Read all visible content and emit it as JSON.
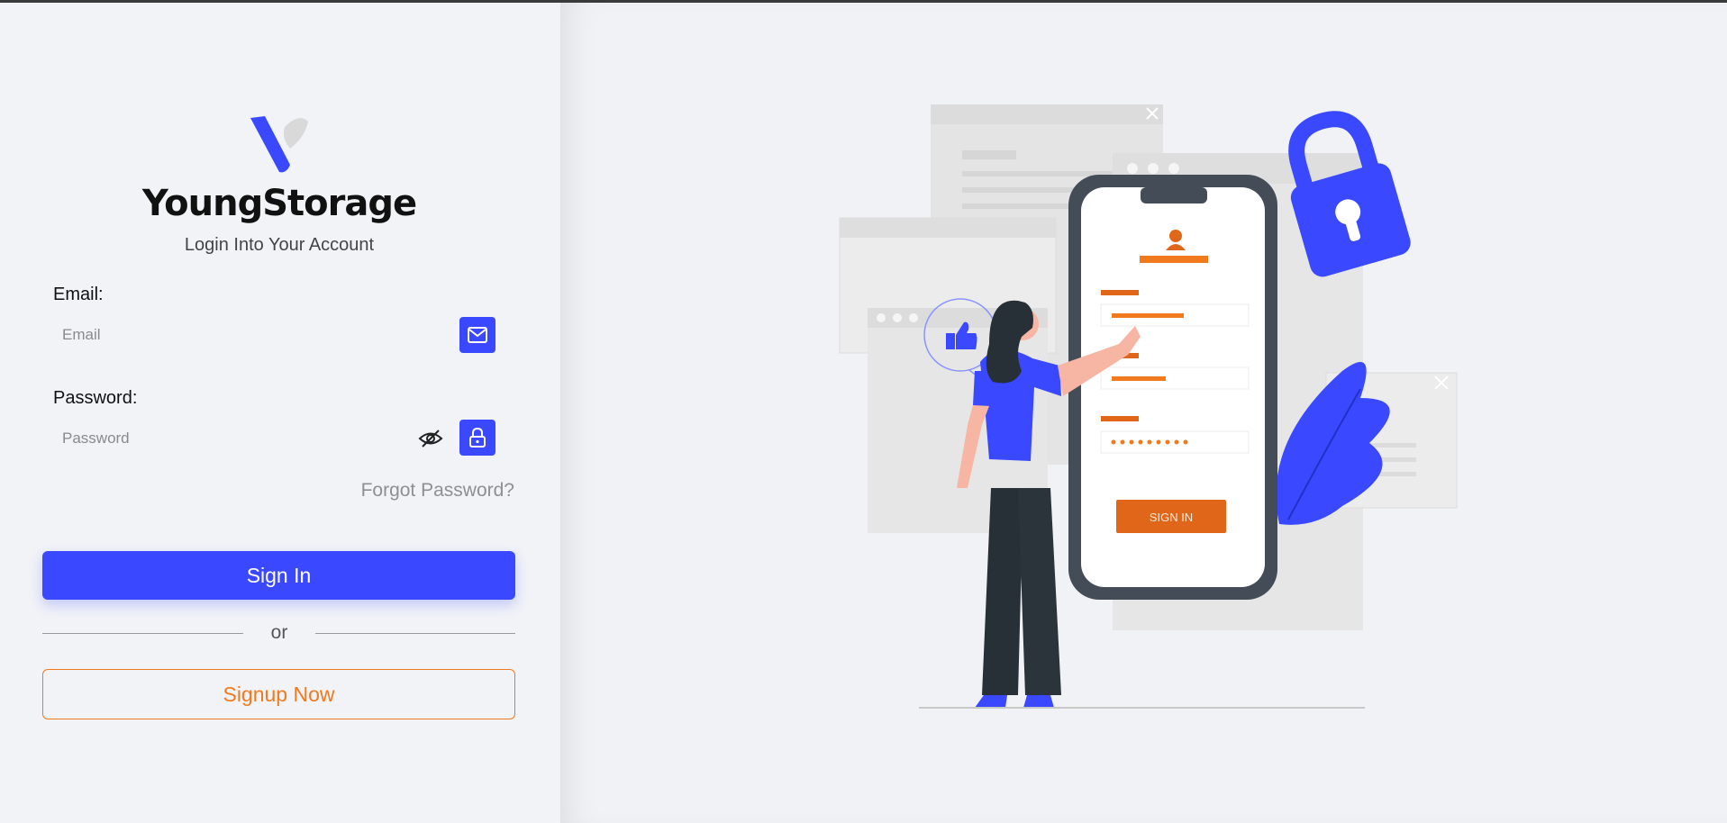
{
  "brand": {
    "name": "YoungStorage",
    "subtitle": "Login Into Your Account"
  },
  "form": {
    "email_label": "Email:",
    "email_placeholder": "Email",
    "email_icon": "envelope-icon",
    "password_label": "Password:",
    "password_placeholder": "Password",
    "visibility_icon": "eye-slash-icon",
    "password_icon": "lock-icon",
    "forgot_label": "Forgot Password?",
    "signin_label": "Sign In",
    "or_label": "or",
    "signup_label": "Signup Now"
  },
  "illustration": {
    "phone_signin_label": "SIGN IN"
  },
  "colors": {
    "accent": "#3a49ff",
    "secondary": "#f07a1d",
    "background": "#f0f2f6"
  }
}
